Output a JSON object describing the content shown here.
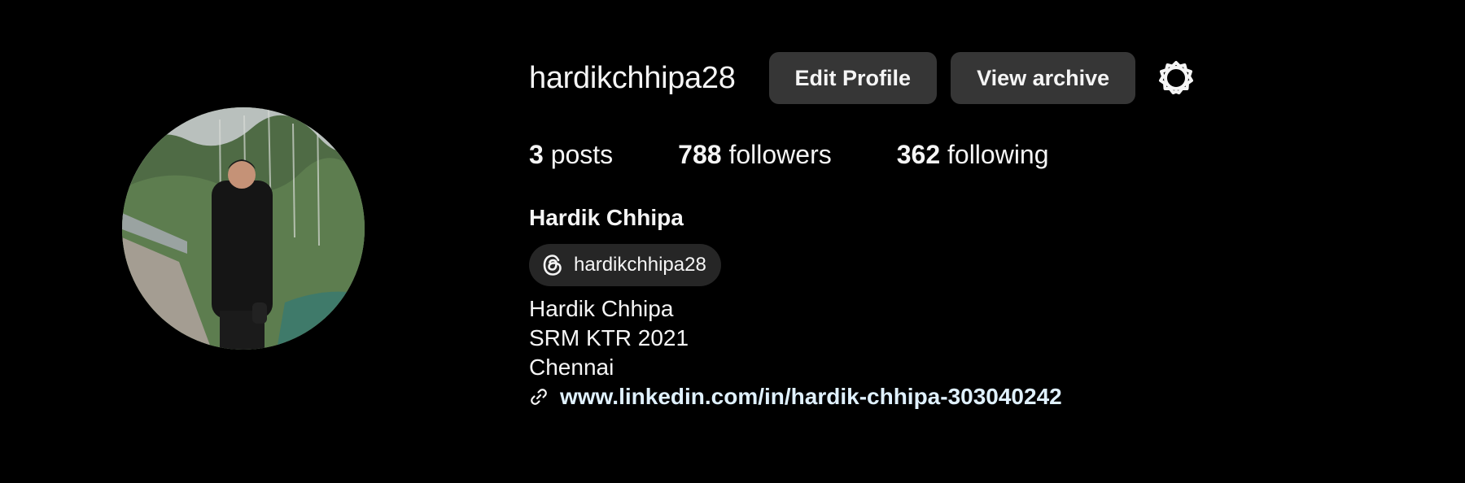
{
  "profile": {
    "username": "hardikchhipa28",
    "full_name": "Hardik Chhipa",
    "avatar_icon": "profile-photo"
  },
  "actions": {
    "edit_profile": "Edit Profile",
    "view_archive": "View archive",
    "settings_icon": "gear-icon"
  },
  "stats": {
    "posts_count": "3",
    "posts_label": "posts",
    "followers_count": "788",
    "followers_label": "followers",
    "following_count": "362",
    "following_label": "following"
  },
  "threads": {
    "handle": "hardikchhipa28",
    "icon": "threads-icon"
  },
  "bio": {
    "lines": [
      "Hardik Chhipa",
      "SRM KTR 2021",
      "Chennai"
    ]
  },
  "link": {
    "text": "www.linkedin.com/in/hardik-chhipa-303040242",
    "icon": "link-icon"
  },
  "colors": {
    "background": "#000000",
    "button": "#363636",
    "pill": "#262626",
    "text": "#f5f5f5",
    "link": "#e0f1ff"
  }
}
